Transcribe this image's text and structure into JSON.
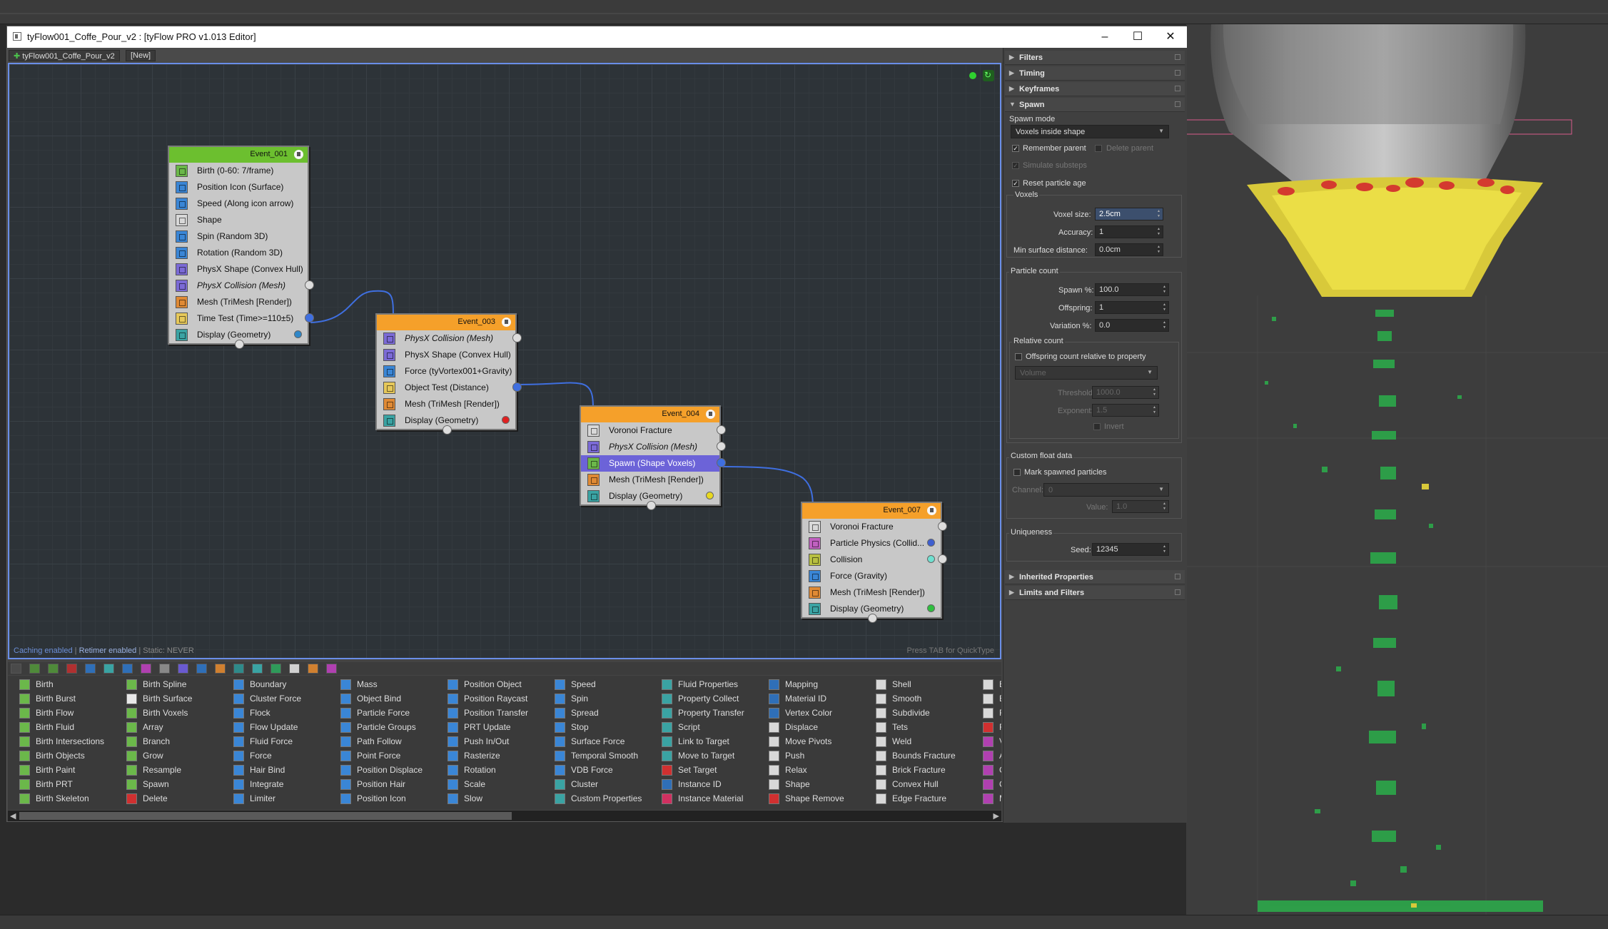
{
  "window": {
    "title": "tyFlow001_Coffe_Pour_v2 : [tyFlow PRO v1.013 Editor]"
  },
  "tabs": {
    "flow": "tyFlow001_Coffe_Pour_v2",
    "new": "[New]"
  },
  "canvas": {
    "caching": "Caching enabled",
    "sep": " | ",
    "retimer": "Retimer enabled",
    "static": " | Static: NEVER",
    "hint": "Press TAB for QuickType"
  },
  "events": [
    {
      "title": "Event_001",
      "color": "#6cbf2f",
      "ops": [
        {
          "label": "Birth (0-60: 7/frame)",
          "icon": "birth-icon",
          "color": "#6bb84a"
        },
        {
          "label": "Position Icon (Surface)",
          "icon": "position-icon",
          "color": "#3a86d6"
        },
        {
          "label": "Speed (Along icon arrow)",
          "icon": "speed-icon",
          "color": "#3a86d6"
        },
        {
          "label": "Shape",
          "icon": "shape-icon",
          "color": "#d8d8d8"
        },
        {
          "label": "Spin (Random 3D)",
          "icon": "spin-icon",
          "color": "#3a86d6"
        },
        {
          "label": "Rotation (Random 3D)",
          "icon": "rotation-icon",
          "color": "#3a86d6"
        },
        {
          "label": "PhysX Shape (Convex Hull)",
          "icon": "physx-shape-icon",
          "color": "#7b6ad6"
        },
        {
          "label": "PhysX Collision (Mesh)",
          "icon": "physx-collision-icon",
          "color": "#7b6ad6",
          "italic": true
        },
        {
          "label": "Mesh (TriMesh [Render])",
          "icon": "mesh-icon",
          "color": "#e08a35"
        },
        {
          "label": "Time Test (Time>=110±5)",
          "icon": "time-test-icon",
          "color": "#e6c85a"
        },
        {
          "label": "Display (Geometry)",
          "icon": "display-icon",
          "color": "#3aa3a3"
        }
      ]
    },
    {
      "title": "Event_003",
      "color": "#f5a02a",
      "ops": [
        {
          "label": "PhysX Collision (Mesh)",
          "icon": "physx-collision-icon",
          "color": "#7b6ad6",
          "italic": true
        },
        {
          "label": "PhysX Shape (Convex Hull)",
          "icon": "physx-shape-icon",
          "color": "#7b6ad6"
        },
        {
          "label": "Force (tyVortex001+Gravity)",
          "icon": "force-icon",
          "color": "#3a86d6"
        },
        {
          "label": "Object Test (Distance)",
          "icon": "object-test-icon",
          "color": "#e6c85a"
        },
        {
          "label": "Mesh (TriMesh [Render])",
          "icon": "mesh-icon",
          "color": "#e08a35"
        },
        {
          "label": "Display (Geometry)",
          "icon": "display-icon",
          "color": "#3aa3a3"
        }
      ]
    },
    {
      "title": "Event_004",
      "color": "#f5a02a",
      "ops": [
        {
          "label": "Voronoi Fracture",
          "icon": "voronoi-icon",
          "color": "#d8d8d8"
        },
        {
          "label": "PhysX Collision (Mesh)",
          "icon": "physx-collision-icon",
          "color": "#7b6ad6",
          "italic": true
        },
        {
          "label": "Spawn (Shape Voxels)",
          "icon": "spawn-icon",
          "color": "#6bb84a",
          "selected": true
        },
        {
          "label": "Mesh (TriMesh [Render])",
          "icon": "mesh-icon",
          "color": "#e08a35"
        },
        {
          "label": "Display (Geometry)",
          "icon": "display-icon",
          "color": "#3aa3a3"
        }
      ]
    },
    {
      "title": "Event_007",
      "color": "#f5a02a",
      "ops": [
        {
          "label": "Voronoi Fracture",
          "icon": "voronoi-icon",
          "color": "#d8d8d8"
        },
        {
          "label": "Particle Physics (Collid...",
          "icon": "particle-physics-icon",
          "color": "#c060c0"
        },
        {
          "label": "Collision",
          "icon": "collision-icon",
          "color": "#b8c040"
        },
        {
          "label": "Force (Gravity)",
          "icon": "force-icon",
          "color": "#3a86d6"
        },
        {
          "label": "Mesh (TriMesh [Render])",
          "icon": "mesh-icon",
          "color": "#e08a35"
        },
        {
          "label": "Display (Geometry)",
          "icon": "display-icon",
          "color": "#3aa3a3"
        }
      ]
    }
  ],
  "depot": [
    [
      "Birth",
      "Birth Burst",
      "Birth Flow",
      "Birth Fluid",
      "Birth Intersections",
      "Birth Objects",
      "Birth Paint",
      "Birth PRT",
      "Birth Skeleton"
    ],
    [
      "Birth Spline",
      "Birth Surface",
      "Birth Voxels",
      "Array",
      "Branch",
      "Grow",
      "Resample",
      "Spawn",
      "Delete"
    ],
    [
      "Boundary",
      "Cluster Force",
      "Flock",
      "Flow Update",
      "Fluid Force",
      "Force",
      "Hair Bind",
      "Integrate",
      "Limiter"
    ],
    [
      "Mass",
      "Object Bind",
      "Particle Force",
      "Particle Groups",
      "Path Follow",
      "Point Force",
      "Position Displace",
      "Position Hair",
      "Position Icon"
    ],
    [
      "Position Object",
      "Position Raycast",
      "Position Transfer",
      "PRT Update",
      "Push In/Out",
      "Rasterize",
      "Rotation",
      "Scale",
      "Slow"
    ],
    [
      "Speed",
      "Spin",
      "Spread",
      "Stop",
      "Surface Force",
      "Temporal Smooth",
      "VDB Force",
      "Cluster",
      "Custom Properties"
    ],
    [
      "Fluid Properties",
      "Property Collect",
      "Property Transfer",
      "Script",
      "Link to Target",
      "Move to Target",
      "Set Target",
      "Instance ID",
      "Instance Material"
    ],
    [
      "Mapping",
      "Material ID",
      "Vertex Color",
      "Displace",
      "Move Pivots",
      "Push",
      "Relax",
      "Shape",
      "Shape Remove"
    ],
    [
      "Shell",
      "Smooth",
      "Subdivide",
      "Tets",
      "Weld",
      "Bounds Fracture",
      "Brick Fracture",
      "Convex Hull",
      "Edge Fracture"
    ],
    [
      "E",
      "E",
      "F",
      "F",
      "V",
      "A",
      "C",
      "C",
      "M"
    ]
  ],
  "props": {
    "rollouts": {
      "filters": "Filters",
      "timing": "Timing",
      "keyframes": "Keyframes",
      "spawn": "Spawn",
      "inherited": "Inherited Properties",
      "limits": "Limits and Filters"
    },
    "spawn_mode_label": "Spawn mode",
    "spawn_mode": "Voxels inside shape",
    "remember_parent": "Remember parent",
    "delete_parent": "Delete parent",
    "simulate_substeps": "Simulate substeps",
    "reset_age": "Reset particle age",
    "voxels_label": "Voxels",
    "voxel_size_label": "Voxel size:",
    "voxel_size": "2.5cm",
    "accuracy_label": "Accuracy:",
    "accuracy": "1",
    "min_dist_label": "Min surface distance:",
    "min_dist": "0.0cm",
    "particle_count_label": "Particle count",
    "spawn_pct_label": "Spawn %:",
    "spawn_pct": "100.0",
    "offspring_label": "Offspring:",
    "offspring": "1",
    "variation_label": "Variation %:",
    "variation": "0.0",
    "relative_count_label": "Relative count",
    "offspring_rel": "Offspring count relative to property",
    "volume": "Volume",
    "threshold_label": "Threshold:",
    "threshold": "1000.0",
    "exponent_label": "Exponent:",
    "exponent": "1.5",
    "invert": "Invert",
    "custom_float_label": "Custom float data",
    "mark_spawned": "Mark spawned particles",
    "channel_label": "Channel:",
    "channel": "0",
    "value_label": "Value:",
    "value": "1.0",
    "uniqueness_label": "Uniqueness",
    "seed_label": "Seed:",
    "seed": "12345"
  }
}
